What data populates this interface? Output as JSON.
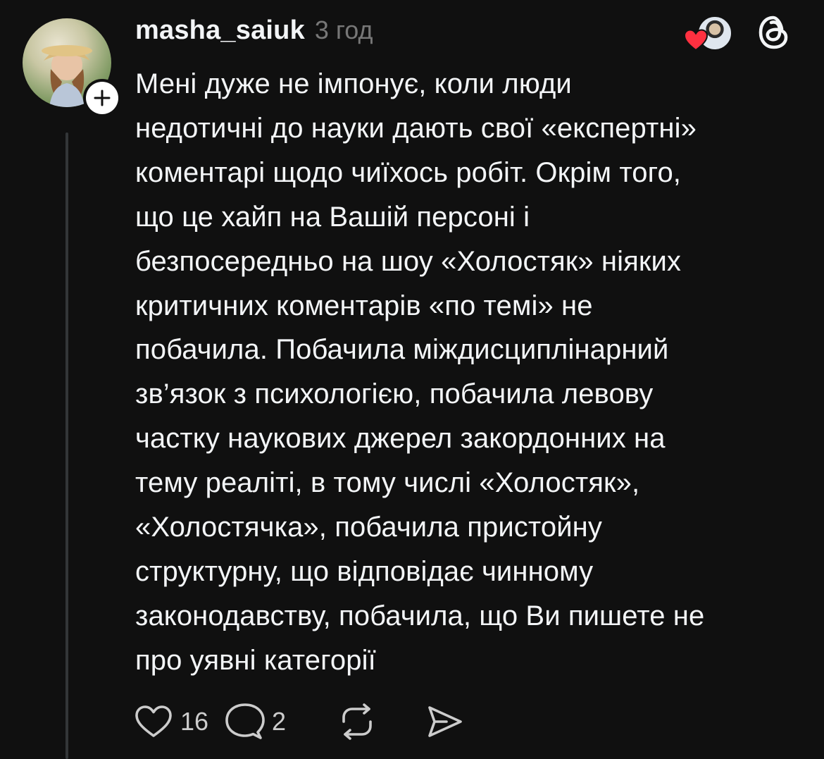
{
  "post": {
    "username": "masha_saiuk",
    "time": "3 год",
    "text_lines": [
      "Мені дуже не імпонує, коли люди",
      "недотичні до науки дають свої «експертні»",
      "коментарі щодо чиїхось робіт. Окрім того,",
      "що це хайп на Вашій персоні і",
      "безпосередньо на шоу «Холостяк» ніяких",
      "критичних коментарів «по темі» не",
      "побачила. Побачила міждисциплінарний",
      "зв’язок з психологією, побачила левову",
      "частку наукових джерел закордонних на",
      "тему реаліті, в тому числі «Холостяк»,",
      "«Холостячка», побачила пристойну",
      "структурну, що відповідає чинному",
      "законодавству, побачила, що Ви пишете не",
      "про уявні категорії"
    ],
    "likes_count": "16",
    "comments_count": "2"
  },
  "icons": {
    "follow": "plus-icon",
    "liked_by": "heart-icon",
    "app": "threads-logo-icon",
    "like": "heart-outline-icon",
    "comment": "comment-bubble-icon",
    "repost": "repost-icon",
    "share": "send-icon"
  },
  "colors": {
    "background": "#101010",
    "text": "#f3f5f7",
    "muted": "#777777",
    "heart_red": "#ff3040",
    "thread_line": "#333638"
  }
}
